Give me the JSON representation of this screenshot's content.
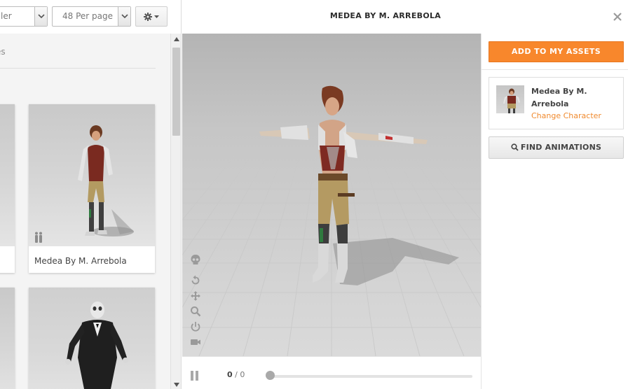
{
  "toolbar": {
    "sort_value": "ler",
    "per_page_value": "48 Per page"
  },
  "filter": {
    "label_fragment": "es"
  },
  "grid": {
    "cards": [
      {
        "name": "Medea By M. Arrebola"
      },
      {
        "name": ""
      }
    ]
  },
  "header": {
    "title": "MEDEA BY M. ARREBOLA"
  },
  "playbar": {
    "frame_current": "0",
    "frame_separator": "/",
    "frame_total": "0"
  },
  "sidebar": {
    "add_button": "ADD TO MY ASSETS",
    "character_name": "Medea By M. Arrebola",
    "change_character": "Change Character",
    "find_button": "FIND ANIMATIONS"
  },
  "icons": {
    "gear": "gear-icon",
    "close": "close-icon",
    "search": "search-icon",
    "pause": "pause-icon",
    "people": "people-icon",
    "skull": "skull-icon",
    "reset": "reset-icon",
    "pan": "pan-icon",
    "zoom": "zoom-icon",
    "power": "power-icon",
    "camera": "camera-icon"
  },
  "colors": {
    "accent": "#f8872c",
    "link": "#f08a2e",
    "viewport_bg": "#b9b9b9"
  }
}
